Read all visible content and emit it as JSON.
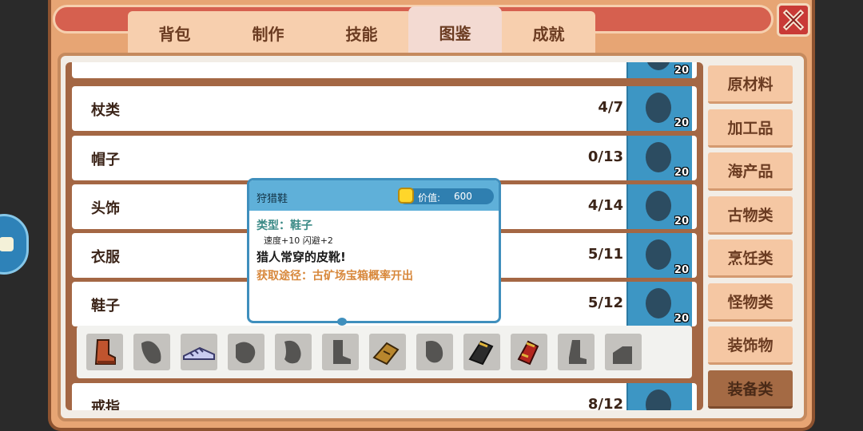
{
  "tabs": [
    {
      "label": "背包",
      "active": false
    },
    {
      "label": "制作",
      "active": false
    },
    {
      "label": "技能",
      "active": false
    },
    {
      "label": "图鉴",
      "active": true
    },
    {
      "label": "成就",
      "active": false
    }
  ],
  "categories": [
    {
      "label": "原材料",
      "active": false
    },
    {
      "label": "加工品",
      "active": false
    },
    {
      "label": "海产品",
      "active": false
    },
    {
      "label": "古物类",
      "active": false
    },
    {
      "label": "烹饪类",
      "active": false
    },
    {
      "label": "怪物类",
      "active": false
    },
    {
      "label": "装饰物",
      "active": false
    },
    {
      "label": "装备类",
      "active": true
    }
  ],
  "rows": [
    {
      "name": "",
      "count": "",
      "reward": "20"
    },
    {
      "name": "杖类",
      "count": "4/7",
      "reward": "20"
    },
    {
      "name": "帽子",
      "count": "0/13",
      "reward": "20"
    },
    {
      "name": "头饰",
      "count": "4/14",
      "reward": "20"
    },
    {
      "name": "衣服",
      "count": "5/11",
      "reward": "20"
    },
    {
      "name": "鞋子",
      "count": "5/12",
      "reward": "20"
    },
    {
      "name": "戒指",
      "count": "8/12",
      "reward": ""
    }
  ],
  "shoes": [
    {
      "icon": "brown-boot-icon",
      "collected": true
    },
    {
      "icon": "shoe-silhouette-icon",
      "collected": false
    },
    {
      "icon": "sneaker-icon",
      "collected": true
    },
    {
      "icon": "shoe-silhouette-icon",
      "collected": false
    },
    {
      "icon": "shoe-silhouette-icon",
      "collected": false
    },
    {
      "icon": "boot-silhouette-icon",
      "collected": false
    },
    {
      "icon": "hunter-shoe-icon",
      "collected": true
    },
    {
      "icon": "shoe-silhouette-icon",
      "collected": false
    },
    {
      "icon": "black-gold-boot-icon",
      "collected": true
    },
    {
      "icon": "red-gold-boot-icon",
      "collected": true
    },
    {
      "icon": "boot-silhouette-icon",
      "collected": false
    },
    {
      "icon": "boot-silhouette-icon",
      "collected": false
    }
  ],
  "tooltip": {
    "name": "狩猎鞋",
    "value_label": "价值:",
    "value": "600",
    "type": "类型：鞋子",
    "stats": "速度+10   闪避+2",
    "description": "猎人常穿的皮靴!",
    "source": "获取途径：古矿场宝箱概率开出"
  },
  "colors": {
    "accent_blue": "#3d96c4",
    "frame": "#e7a574",
    "title_red": "#d6604f",
    "text_brown": "#6b3c22"
  }
}
